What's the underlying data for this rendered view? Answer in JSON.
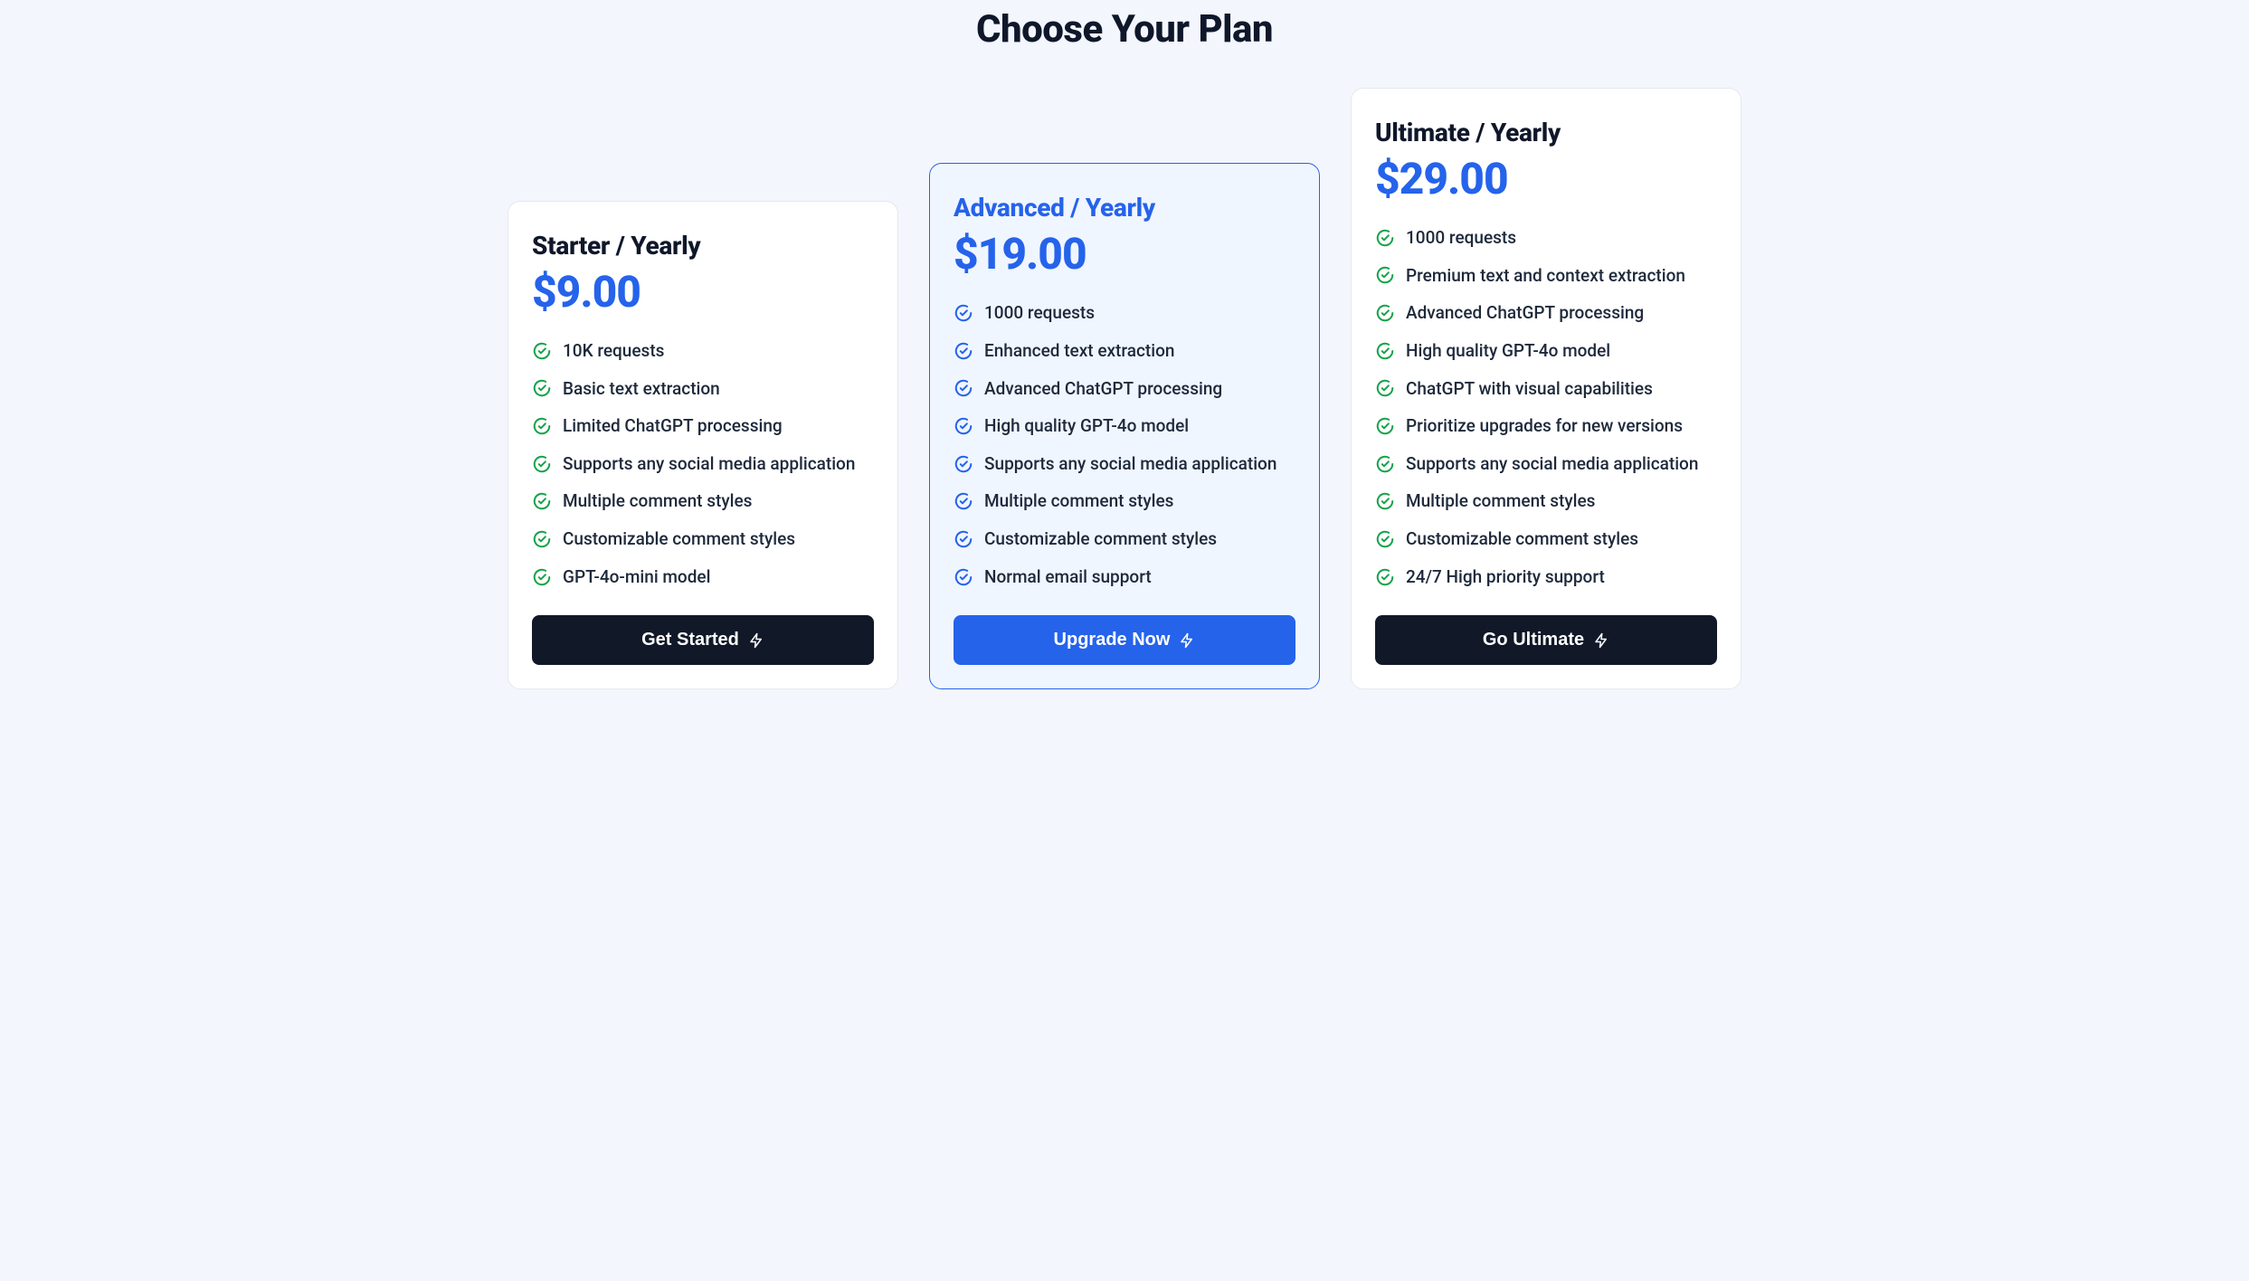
{
  "title": "Choose Your Plan",
  "colors": {
    "accent_blue": "#2563eb",
    "check_green": "#16a34a",
    "check_blue": "#2563eb",
    "cta_dark": "#111827"
  },
  "plans": [
    {
      "name": "Starter / Yearly",
      "price": "$9.00",
      "highlighted": false,
      "check_color": "green",
      "cta_label": "Get Started",
      "cta_style": "dark",
      "features": [
        "10K requests",
        "Basic text extraction",
        "Limited ChatGPT processing",
        "Supports any social media application",
        "Multiple comment styles",
        "Customizable comment styles",
        "GPT-4o-mini model"
      ]
    },
    {
      "name": "Advanced / Yearly",
      "price": "$19.00",
      "highlighted": true,
      "check_color": "blue",
      "cta_label": "Upgrade Now",
      "cta_style": "blue",
      "features": [
        "1000 requests",
        "Enhanced text extraction",
        "Advanced ChatGPT processing",
        "High quality GPT-4o model",
        "Supports any social media application",
        "Multiple comment styles",
        "Customizable comment styles",
        "Normal email support"
      ]
    },
    {
      "name": "Ultimate / Yearly",
      "price": "$29.00",
      "highlighted": false,
      "check_color": "green",
      "cta_label": "Go Ultimate",
      "cta_style": "dark",
      "features": [
        "1000 requests",
        "Premium text and context extraction",
        "Advanced ChatGPT processing",
        "High quality GPT-4o model",
        "ChatGPT with visual capabilities",
        "Prioritize upgrades for new versions",
        "Supports any social media application",
        "Multiple comment styles",
        "Customizable comment styles",
        "24/7 High priority support"
      ]
    }
  ]
}
